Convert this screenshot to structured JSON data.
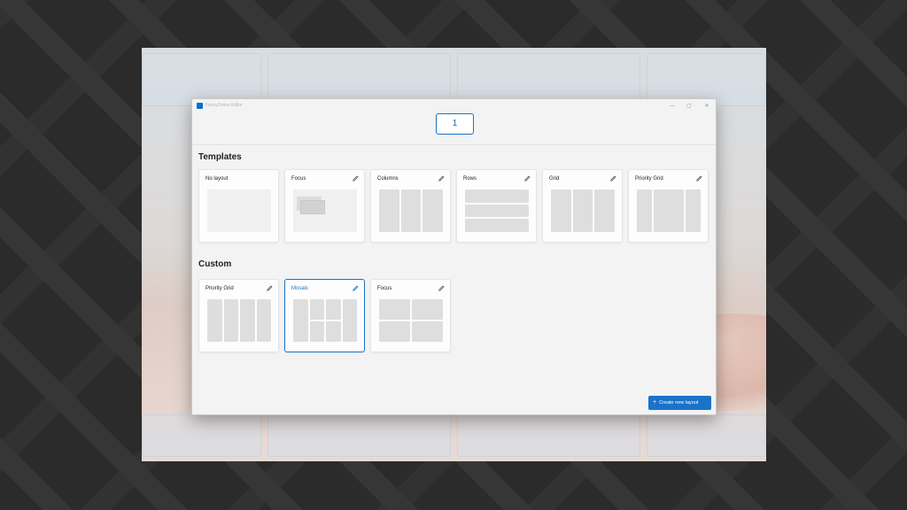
{
  "window": {
    "title": "FancyZones Editor",
    "controls": {
      "minimize": "—",
      "maximize": "▢",
      "close": "✕"
    }
  },
  "monitor": {
    "label": "1"
  },
  "templates": {
    "title": "Templates",
    "items": [
      {
        "label": "No layout",
        "editable": false,
        "preview": "empty"
      },
      {
        "label": "Focus",
        "editable": true,
        "preview": "focus"
      },
      {
        "label": "Columns",
        "editable": true,
        "preview": "columns"
      },
      {
        "label": "Rows",
        "editable": true,
        "preview": "rows"
      },
      {
        "label": "Grid",
        "editable": true,
        "preview": "grid"
      },
      {
        "label": "Priority Grid",
        "editable": true,
        "preview": "priority-grid"
      }
    ]
  },
  "custom": {
    "title": "Custom",
    "items": [
      {
        "label": "Priority Grid",
        "editable": true,
        "selected": false,
        "preview": "priority-grid-custom"
      },
      {
        "label": "Mosaic",
        "editable": true,
        "selected": true,
        "preview": "mosaic"
      },
      {
        "label": "Focus",
        "editable": true,
        "selected": false,
        "preview": "grid-2x2"
      }
    ]
  },
  "actions": {
    "create_label": "Create new layout",
    "create_icon": "plus-icon"
  },
  "colors": {
    "accent": "#1a73c8",
    "window_bg": "#f3f3f3",
    "card_bg": "#fdfdfd",
    "zone": "#dedede"
  }
}
